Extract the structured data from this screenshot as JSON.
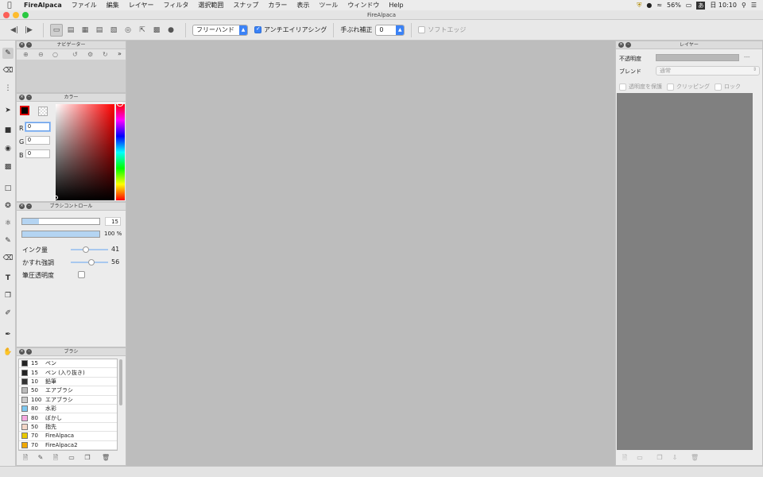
{
  "menubar": {
    "app": "FireAlpaca",
    "items": [
      "ファイル",
      "編集",
      "レイヤー",
      "フィルタ",
      "選択範囲",
      "スナップ",
      "カラー",
      "表示",
      "ツール",
      "ウィンドウ",
      "Help"
    ],
    "battery": "56%",
    "clock": "日 10:10"
  },
  "window": {
    "title": "FireAlpaca"
  },
  "toolbar": {
    "mode": "フリーハンド",
    "antialias_label": "アンチエイリアシング",
    "stabilizer_label": "手ぶれ補正",
    "stabilizer_value": "0",
    "soft_edge_label": "ソフトエッジ"
  },
  "navigator": {
    "title": "ナビゲーター"
  },
  "color": {
    "title": "カラー",
    "r_label": "R",
    "r_value": "0",
    "g_label": "G",
    "g_value": "0",
    "b_label": "B",
    "b_value": "0",
    "fg": "#000000"
  },
  "brush_control": {
    "title": "ブラシコントロール",
    "size_value": "15",
    "size_fraction": 0.22,
    "opacity_value": "100 %",
    "opacity_fraction": 1.0,
    "ink_label": "インク量",
    "ink_value": "41",
    "blur_label": "かすれ強調",
    "blur_value": "56",
    "pressure_label": "筆圧透明度"
  },
  "brushes": {
    "title": "ブラシ",
    "items": [
      {
        "size": "15",
        "name": "ペン",
        "color": "#222222"
      },
      {
        "size": "15",
        "name": "ペン (入り抜き)",
        "color": "#222222"
      },
      {
        "size": "10",
        "name": "鉛筆",
        "color": "#333333"
      },
      {
        "size": "50",
        "name": "エアブラシ",
        "color": "#bbbbbb"
      },
      {
        "size": "100",
        "name": "エアブラシ",
        "color": "#cccccc"
      },
      {
        "size": "80",
        "name": "水彩",
        "color": "#7ec8f0"
      },
      {
        "size": "80",
        "name": "ぼかし",
        "color": "#f7a8e0"
      },
      {
        "size": "50",
        "name": "指先",
        "color": "#f4d6c6"
      },
      {
        "size": "70",
        "name": "FireAlpaca",
        "color": "#e8c800"
      },
      {
        "size": "70",
        "name": "FireAlpaca2",
        "color": "#f0a800"
      }
    ]
  },
  "layers": {
    "title": "レイヤー",
    "opacity_label": "不透明度",
    "opacity_value": "---",
    "blend_label": "ブレンド",
    "blend_value": "通常",
    "protect_label": "透明度を保護",
    "clip_label": "クリッピング",
    "lock_label": "ロック"
  }
}
